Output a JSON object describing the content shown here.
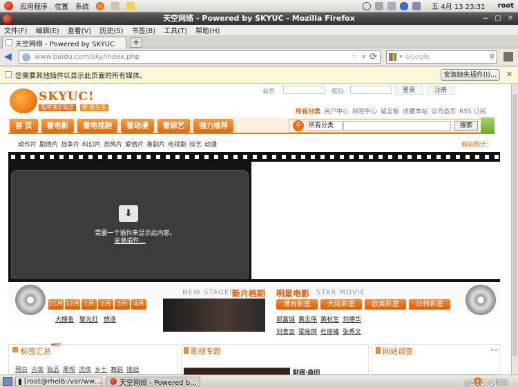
{
  "panel": {
    "apps": "应用程序",
    "places": "位置",
    "system": "系统",
    "date": "五 4月 13 23:31",
    "user": "root"
  },
  "window": {
    "title": "天空网络 - Powered by SKYUC - Mozilla Firefox"
  },
  "menus": [
    "文件(F)",
    "编辑(E)",
    "查看(V)",
    "历史(S)",
    "书签(B)",
    "工具(T)",
    "帮助(H)"
  ],
  "tab": {
    "label": "天空网络 - Powered by SKYUC"
  },
  "nav": {
    "url": "www.baidu.com/sky/index.php",
    "search_placeholder": "Google"
  },
  "plugin_bar": {
    "message": "您需要其他插件以显示此页面的所有媒体。",
    "button": "安装缺失插件(I)…"
  },
  "site": {
    "logo": "SKYUC!",
    "tagline": "程序演示站点",
    "tagline2": "新·影生活",
    "login": {
      "member": "会员",
      "password": "密码",
      "login_btn": "登录",
      "register_btn": "注册"
    },
    "top_links": [
      "所有分类",
      "用户中心",
      "网吧中心",
      "留言板",
      "收藏本站",
      "设为首页",
      "RSS 订阅"
    ],
    "main_nav": [
      "首 页",
      "看电影",
      "看电视剧",
      "看动漫",
      "看综艺",
      "强力推荐"
    ],
    "category_select": "所有分类",
    "search_btn": "搜索",
    "sub_nav": [
      "动作片",
      "剧情片",
      "战争片",
      "科幻片",
      "恐怖片",
      "爱情片",
      "喜剧片",
      "电视剧",
      "综艺",
      "动漫"
    ],
    "site_stats": "网站统计：",
    "plugin_msg": "需要一个插件来显示此内容。",
    "install_plugin": "安装插件…",
    "new_stages": "NEW STAGES",
    "new_title": "新片档期",
    "months": [
      "11月",
      "12月",
      "1月",
      "2月",
      "3月",
      "4月"
    ],
    "new_links": [
      "大搜查",
      "聚光灯",
      "放逐"
    ],
    "star_title": "明星电影",
    "star_en": "STAR MOVIE",
    "star_tabs": [
      "港台影星",
      "大陆影星",
      "欧美影星",
      "日韩影星"
    ],
    "stars": [
      "郭富城",
      "黄志伟",
      "黄秋生",
      "刘德华",
      "刘青云",
      "梁咏琪",
      "杜丽峰",
      "张秀文"
    ],
    "tags_title": "标签汇总",
    "hot": "HOT",
    "tags": [
      "预日",
      "古装",
      "独品",
      "黑帮",
      "武侠",
      "乡土",
      "舞蹈",
      "接战"
    ],
    "topics_title": "影视专题",
    "topic_caption": "财阀·森田",
    "survey_title": "网站调查"
  },
  "taskbar": {
    "task1": "[root@rhel6:/var/ww…",
    "task2": "天空网络 - Powered b…"
  },
  "watermark": "@51CTO博客"
}
